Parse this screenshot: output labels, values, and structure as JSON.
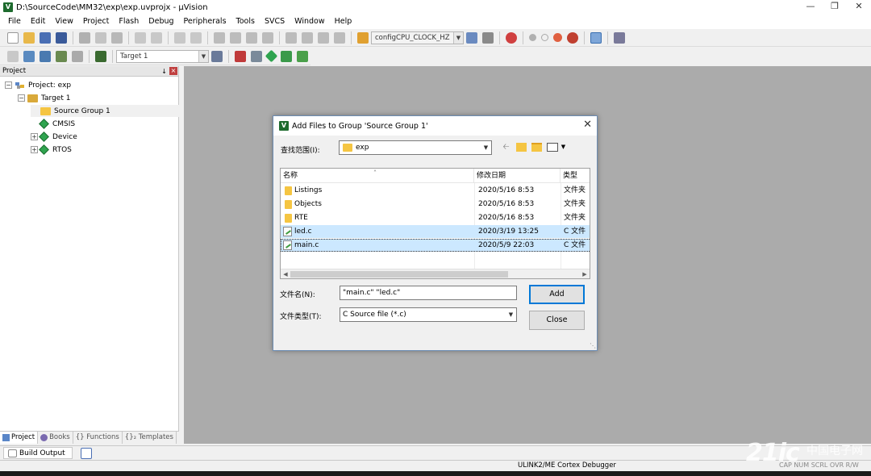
{
  "window": {
    "title": "D:\\SourceCode\\MM32\\exp\\exp.uvprojx - µVision",
    "app_icon_letter": "V"
  },
  "menu": [
    "File",
    "Edit",
    "View",
    "Project",
    "Flash",
    "Debug",
    "Peripherals",
    "Tools",
    "SVCS",
    "Window",
    "Help"
  ],
  "toolbar": {
    "find_combo": "configCPU_CLOCK_HZ",
    "target_combo": "Target 1"
  },
  "project_panel": {
    "header": "Project",
    "pin_glyph": "↓",
    "close_glyph": "×",
    "tree": {
      "project": "Project: exp",
      "target": "Target 1",
      "group": "Source Group 1",
      "cmsis": "CMSIS",
      "device": "Device",
      "rtos": "RTOS"
    },
    "tabs": [
      "Project",
      "Books",
      "{} Functions",
      "{}₂ Templates"
    ]
  },
  "build_output": "Build Output",
  "status": {
    "debugger": "ULINK2/ME Cortex Debugger",
    "caps": "CAP NUM SCRL OVR R/W"
  },
  "dialog": {
    "title": "Add Files to Group 'Source Group 1'",
    "close_glyph": "✕",
    "look_in_label": "查找范围(I):",
    "look_in_value": "exp",
    "columns": [
      "名称",
      "修改日期",
      "类型"
    ],
    "files": [
      {
        "name": "Listings",
        "date": "2020/5/16 8:53",
        "type": "文件夹",
        "kind": "folder"
      },
      {
        "name": "Objects",
        "date": "2020/5/16 8:53",
        "type": "文件夹",
        "kind": "folder"
      },
      {
        "name": "RTE",
        "date": "2020/5/16 8:53",
        "type": "文件夹",
        "kind": "folder"
      },
      {
        "name": "led.c",
        "date": "2020/3/19 13:25",
        "type": "C 文件",
        "kind": "cfile"
      },
      {
        "name": "main.c",
        "date": "2020/5/9 22:03",
        "type": "C 文件",
        "kind": "cfile"
      }
    ],
    "filename_label": "文件名(N):",
    "filename_value": "\"main.c\" \"led.c\"",
    "filetype_label": "文件类型(T):",
    "filetype_value": "C Source file (*.c)",
    "add_button": "Add",
    "close_button": "Close"
  },
  "watermark": {
    "logo": "21ic",
    "text": "中国电子网"
  },
  "colors": {
    "workspace": "#ababab",
    "selection": "#cce8ff",
    "accent": "#0078d7"
  }
}
